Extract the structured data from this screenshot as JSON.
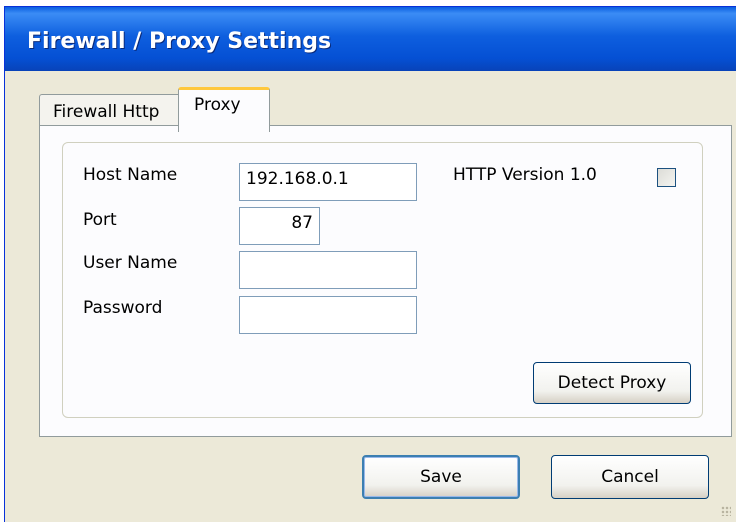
{
  "window": {
    "title": "Firewall / Proxy Settings"
  },
  "tabs": [
    {
      "label": "Firewall Http",
      "selected": false
    },
    {
      "label": "Proxy",
      "selected": true
    }
  ],
  "proxy": {
    "host_name_label": "Host Name",
    "host_name_value": "192.168.0.1",
    "port_label": "Port",
    "port_value": "87",
    "user_name_label": "User Name",
    "user_name_value": "",
    "password_label": "Password",
    "password_value": "",
    "http_version_label": "HTTP Version 1.0",
    "http_version_checked": false,
    "detect_proxy_label": "Detect Proxy"
  },
  "footer": {
    "save_label": "Save",
    "cancel_label": "Cancel"
  },
  "colors": {
    "titlebar": "#0550d4",
    "window_bg": "#ece9d8",
    "tab_highlight": "#ffc83c"
  }
}
